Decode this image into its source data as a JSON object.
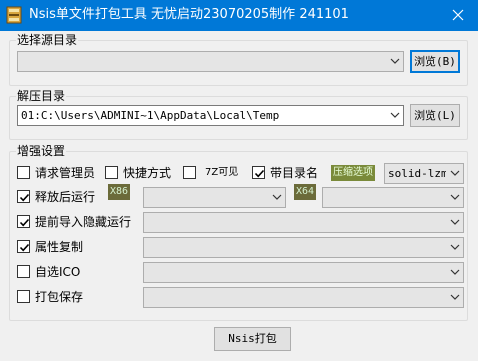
{
  "window": {
    "title": "Nsis单文件打包工具 无忧启动23070205制作 241101",
    "close_glyph": "✕"
  },
  "source": {
    "legend": "选择源目录",
    "path_value": "",
    "browse_label": "浏览(B)"
  },
  "extract": {
    "legend": "解压目录",
    "path_value": "01:C:\\Users\\ADMINI~1\\AppData\\Local\\Temp",
    "browse_label": "浏览(L)"
  },
  "enhance": {
    "legend": "增强设置",
    "request_admin": {
      "label": "请求管理员",
      "checked": false
    },
    "shortcut": {
      "label": "快捷方式",
      "checked": false
    },
    "sevenzip_visible": {
      "label": "7Z可见",
      "checked": false
    },
    "with_dirname": {
      "label": "带目录名",
      "checked": true
    },
    "compress_tag": "压缩选项",
    "compress_value": "solid-lzma",
    "run_after_extract": {
      "label": "释放后运行",
      "checked": true
    },
    "x86_tag": "X86",
    "x86_value": "",
    "x64_tag": "X64",
    "x64_value": "",
    "pre_import_hidden": {
      "label": "提前导入隐藏运行",
      "checked": true
    },
    "pre_import_value": "",
    "copy_attributes": {
      "label": "属性复制",
      "checked": true
    },
    "copy_attributes_value": "",
    "custom_ico": {
      "label": "自选ICO",
      "checked": false
    },
    "custom_ico_value": "",
    "pack_save": {
      "label": "打包保存",
      "checked": false
    },
    "pack_save_value": ""
  },
  "footer": {
    "pack_button": "Nsis打包"
  },
  "colors": {
    "titlebar": "#0078d7",
    "focus_border": "#0078d7",
    "tag_bg": "#6b6b3a"
  }
}
